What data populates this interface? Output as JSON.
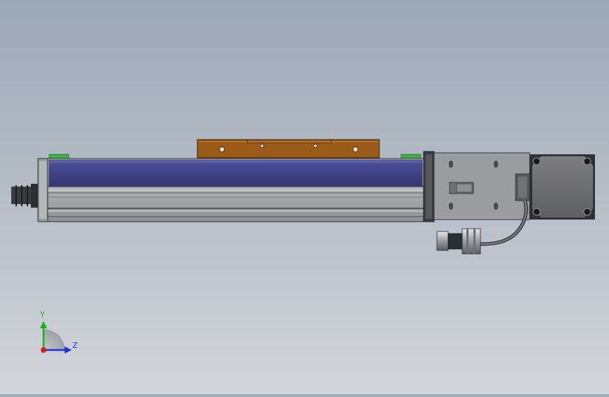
{
  "triad": {
    "y_label": "Y",
    "z_label": "Z",
    "colors": {
      "y": "#16b21a",
      "z": "#1f2fd8",
      "x": "#d42020"
    }
  },
  "colors": {
    "carriage": "#9a5a18",
    "cover": "#3e4189",
    "body": "#b3b6b9",
    "green_caps": "#3fae4a"
  }
}
